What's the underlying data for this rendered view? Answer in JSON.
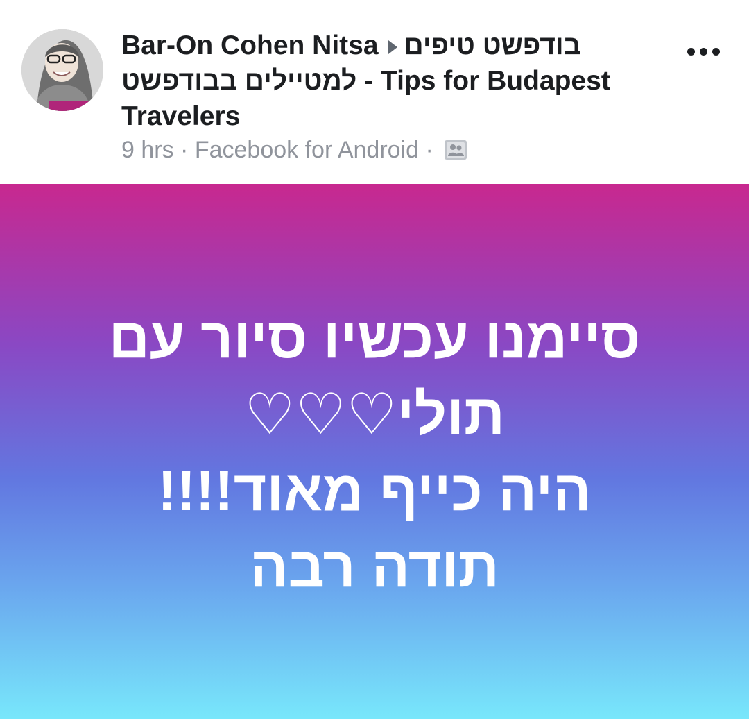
{
  "header": {
    "author_name": "Bar-On Cohen Nitsa",
    "group_name": "בודפשט טיפים למטיילים בבודפשט - Tips for Budapest Travelers",
    "time": "9 hrs",
    "separator": "·",
    "source": "Facebook for Android",
    "audience_icon": "group-privacy-icon",
    "more_icon": "more-options-icon"
  },
  "post": {
    "lines": [
      "סיימנו עכשיו סיור עם",
      "תולי♡♡♡",
      "היה כייף מאוד!!!!",
      "תודה רבה"
    ],
    "background_gradient": {
      "top": "#c8288f",
      "middle": "#6277e0",
      "bottom": "#78e7fb"
    },
    "text_color": "#ffffff"
  }
}
